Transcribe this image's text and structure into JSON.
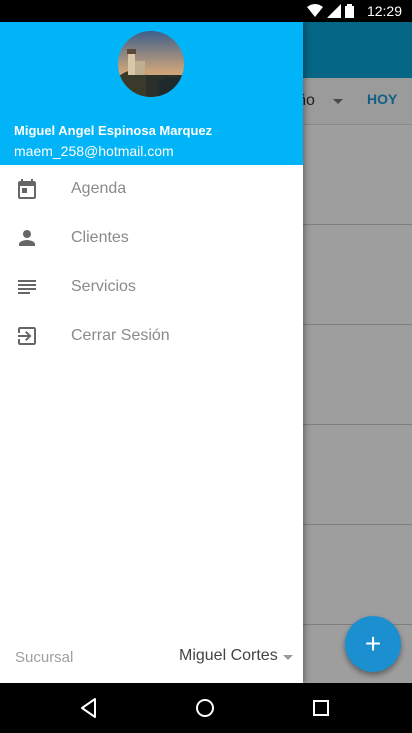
{
  "status_bar": {
    "time": "12:29"
  },
  "background_screen": {
    "filter_value": "liño",
    "today_button": "HOY",
    "fab_label": "+"
  },
  "drawer": {
    "user_name": "Miguel Angel Espinosa Marquez",
    "user_email": "maem_258@hotmail.com",
    "items": [
      {
        "label": "Agenda",
        "icon": "calendar-icon"
      },
      {
        "label": "Clientes",
        "icon": "person-icon"
      },
      {
        "label": "Servicios",
        "icon": "list-icon"
      },
      {
        "label": "Cerrar Sesión",
        "icon": "logout-icon"
      }
    ],
    "footer": {
      "label": "Sucursal",
      "value": "Miguel Cortes"
    }
  },
  "colors": {
    "header": "#00b4f7",
    "toolbar": "#0aa5d8",
    "fab": "#1b8fcf",
    "accent": "#1a9bd7"
  }
}
